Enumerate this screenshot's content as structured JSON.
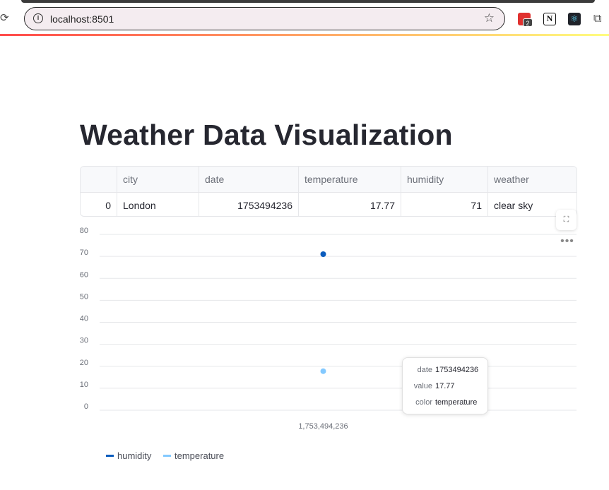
{
  "browser": {
    "url": "localhost:8501",
    "extensions": [
      {
        "name": "todoist-icon",
        "badge": "2"
      },
      {
        "name": "notion-icon",
        "glyph": "N"
      },
      {
        "name": "react-devtools-icon"
      },
      {
        "name": "extensions-puzzle-icon"
      }
    ]
  },
  "app": {
    "title": "Weather Data Visualization"
  },
  "table": {
    "columns": [
      "",
      "city",
      "date",
      "temperature",
      "humidity",
      "weather"
    ],
    "rows": [
      [
        "0",
        "London",
        "1753494236",
        "17.77",
        "71",
        "clear sky"
      ]
    ]
  },
  "chart_data": {
    "type": "scatter",
    "x_tick_labels": [
      "1,753,494,236"
    ],
    "ylim": [
      0,
      80
    ],
    "y_ticks": [
      0,
      10,
      20,
      30,
      40,
      50,
      60,
      70,
      80
    ],
    "grid": true,
    "legend_position": "bottom-left",
    "series": [
      {
        "name": "humidity",
        "color": "#0b5cbd",
        "x": [
          1753494236
        ],
        "y": [
          71
        ]
      },
      {
        "name": "temperature",
        "color": "#83c9ff",
        "x": [
          1753494236
        ],
        "y": [
          17.77
        ]
      }
    ],
    "tooltip": {
      "rows": [
        {
          "key": "date",
          "value": "1753494236"
        },
        {
          "key": "value",
          "value": "17.77"
        },
        {
          "key": "color",
          "value": "temperature"
        }
      ]
    }
  },
  "colors": {
    "accent_red": "#ff4b4b",
    "accent_yellow": "#fffd80"
  }
}
